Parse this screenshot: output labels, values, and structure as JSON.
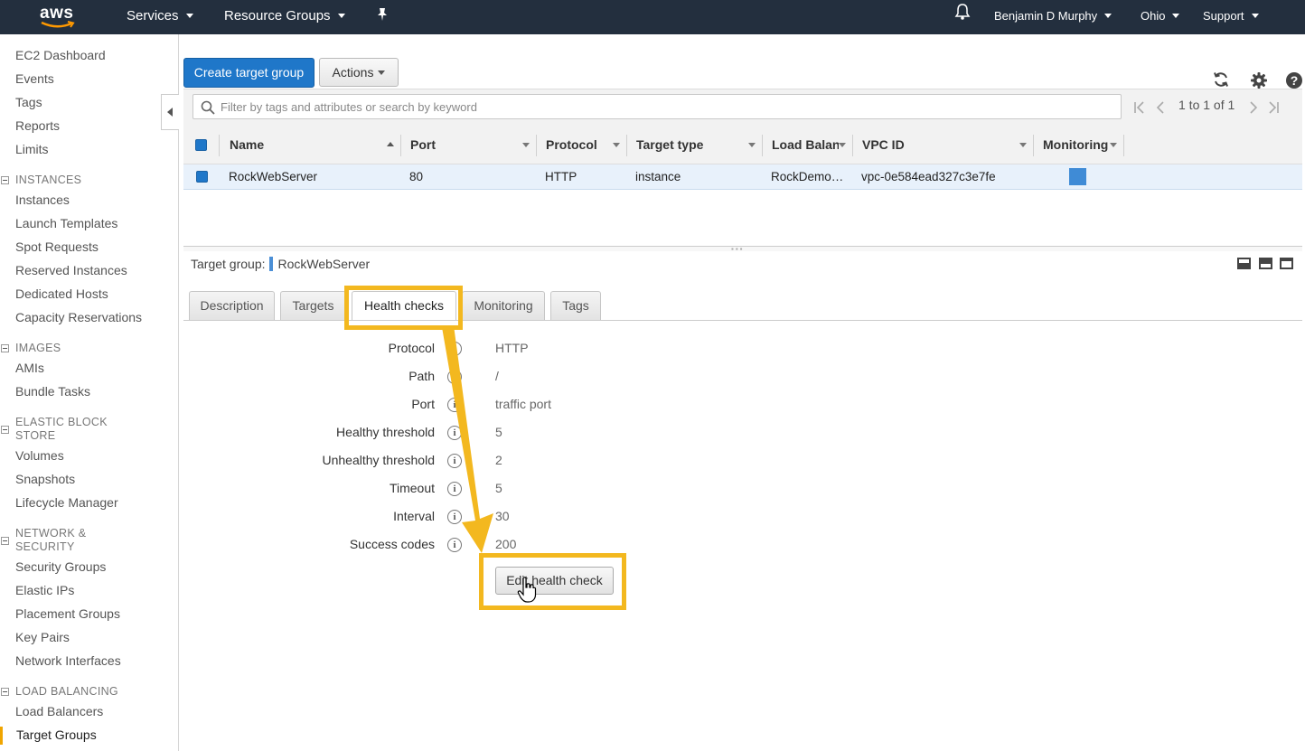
{
  "topnav": {
    "logo_text": "aws",
    "services": "Services",
    "resource_groups": "Resource Groups",
    "user": "Benjamin D Murphy",
    "region": "Ohio",
    "support": "Support"
  },
  "sidebar": {
    "top_links": [
      "EC2 Dashboard",
      "Events",
      "Tags",
      "Reports",
      "Limits"
    ],
    "sections": [
      {
        "title": "INSTANCES",
        "items": [
          "Instances",
          "Launch Templates",
          "Spot Requests",
          "Reserved Instances",
          "Dedicated Hosts",
          "Capacity Reservations"
        ]
      },
      {
        "title": "IMAGES",
        "items": [
          "AMIs",
          "Bundle Tasks"
        ]
      },
      {
        "title": "ELASTIC BLOCK STORE",
        "title_line1": "ELASTIC BLOCK",
        "title_line2": "STORE",
        "items": [
          "Volumes",
          "Snapshots",
          "Lifecycle Manager"
        ]
      },
      {
        "title": "NETWORK & SECURITY",
        "title_line1": "NETWORK &",
        "title_line2": "SECURITY",
        "items": [
          "Security Groups",
          "Elastic IPs",
          "Placement Groups",
          "Key Pairs",
          "Network Interfaces"
        ]
      },
      {
        "title": "LOAD BALANCING",
        "items": [
          "Load Balancers",
          "Target Groups"
        ]
      }
    ],
    "active_item": "Target Groups"
  },
  "toolbar": {
    "create_button": "Create target group",
    "actions_button": "Actions",
    "search_placeholder": "Filter by tags and attributes or search by keyword",
    "pagination": "1 to 1 of 1"
  },
  "table": {
    "columns": [
      "Name",
      "Port",
      "Protocol",
      "Target type",
      "Load Balanc",
      "VPC ID",
      "Monitoring"
    ],
    "rows": [
      {
        "name": "RockWebServer",
        "port": "80",
        "protocol": "HTTP",
        "target_type": "instance",
        "load_balancer": "RockDemo…",
        "vpc_id": "vpc-0e584ead327c3e7fe",
        "selected": true
      }
    ]
  },
  "detail": {
    "label": "Target group:",
    "name": "RockWebServer",
    "tabs": [
      "Description",
      "Targets",
      "Health checks",
      "Monitoring",
      "Tags"
    ],
    "active_tab": "Health checks",
    "fields": [
      {
        "label": "Protocol",
        "value": "HTTP"
      },
      {
        "label": "Path",
        "value": "/"
      },
      {
        "label": "Port",
        "value": "traffic port"
      },
      {
        "label": "Healthy threshold",
        "value": "5"
      },
      {
        "label": "Unhealthy threshold",
        "value": "2"
      },
      {
        "label": "Timeout",
        "value": "5"
      },
      {
        "label": "Interval",
        "value": "30"
      },
      {
        "label": "Success codes",
        "value": "200"
      }
    ],
    "info_glyph": "i",
    "edit_button": "Edit health check"
  },
  "colors": {
    "nav_bg": "#232f3e",
    "primary": "#1f77c9",
    "highlight": "#f3b81f",
    "aws_smile": "#ff9900"
  }
}
